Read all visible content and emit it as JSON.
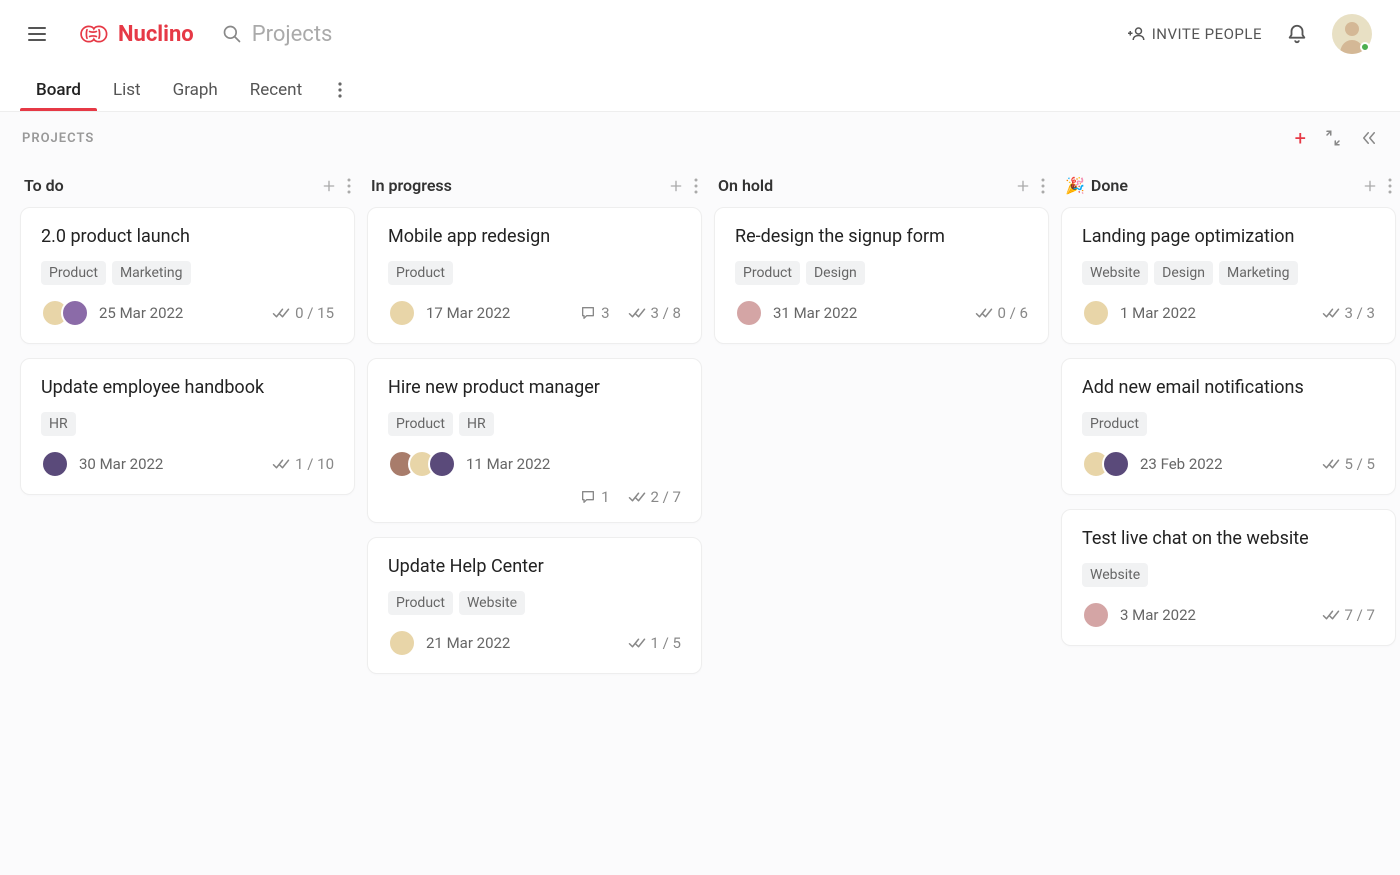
{
  "header": {
    "app_name": "Nuclino",
    "search_placeholder": "Projects",
    "invite_label": "INVITE PEOPLE"
  },
  "tabs": {
    "items": [
      "Board",
      "List",
      "Graph",
      "Recent"
    ],
    "active_index": 0
  },
  "board": {
    "label": "PROJECTS"
  },
  "columns": [
    {
      "title": "To do",
      "icon": "",
      "cards": [
        {
          "title": "2.0 product launch",
          "tags": [
            "Product",
            "Marketing"
          ],
          "avatars": [
            "avc-1",
            "avc-2"
          ],
          "date": "25 Mar 2022",
          "comments": null,
          "checks": "0 / 15"
        },
        {
          "title": "Update employee handbook",
          "tags": [
            "HR"
          ],
          "avatars": [
            "avc-4"
          ],
          "date": "30 Mar 2022",
          "comments": null,
          "checks": "1 / 10"
        }
      ]
    },
    {
      "title": "In progress",
      "icon": "",
      "cards": [
        {
          "title": "Mobile app redesign",
          "tags": [
            "Product"
          ],
          "avatars": [
            "avc-1"
          ],
          "date": "17 Mar 2022",
          "comments": "3",
          "checks": "3 / 8"
        },
        {
          "title": "Hire new product manager",
          "tags": [
            "Product",
            "HR"
          ],
          "avatars": [
            "avc-6",
            "avc-1",
            "avc-4"
          ],
          "date": "11 Mar 2022",
          "comments": "1",
          "checks": "2 / 7",
          "two_line_foot": true
        },
        {
          "title": "Update Help Center",
          "tags": [
            "Product",
            "Website"
          ],
          "avatars": [
            "avc-1"
          ],
          "date": "21 Mar 2022",
          "comments": null,
          "checks": "1 / 5"
        }
      ]
    },
    {
      "title": "On hold",
      "icon": "",
      "cards": [
        {
          "title": "Re-design the signup form",
          "tags": [
            "Product",
            "Design"
          ],
          "avatars": [
            "avc-5"
          ],
          "date": "31 Mar 2022",
          "comments": null,
          "checks": "0 / 6"
        }
      ]
    },
    {
      "title": "Done",
      "icon": "🎉",
      "cards": [
        {
          "title": "Landing page optimization",
          "tags": [
            "Website",
            "Design",
            "Marketing"
          ],
          "avatars": [
            "avc-1"
          ],
          "date": "1 Mar 2022",
          "comments": null,
          "checks": "3 / 3"
        },
        {
          "title": "Add new email notifications",
          "tags": [
            "Product"
          ],
          "avatars": [
            "avc-1",
            "avc-4"
          ],
          "date": "23 Feb 2022",
          "comments": null,
          "checks": "5 / 5"
        },
        {
          "title": "Test live chat on the website",
          "tags": [
            "Website"
          ],
          "avatars": [
            "avc-5"
          ],
          "date": "3 Mar 2022",
          "comments": null,
          "checks": "7 / 7"
        }
      ]
    }
  ]
}
